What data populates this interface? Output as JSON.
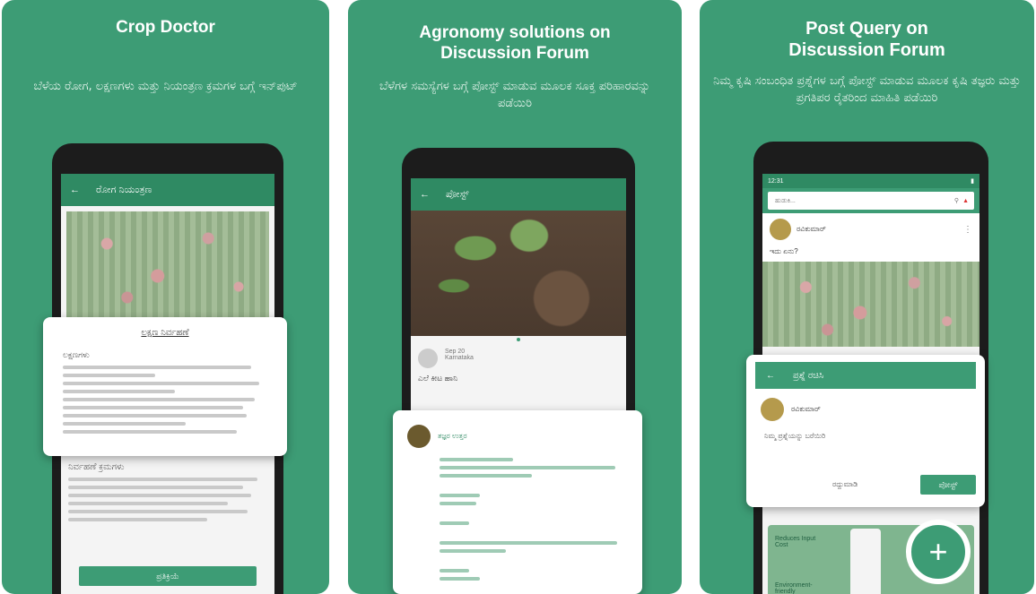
{
  "panels": [
    {
      "title": "Crop Doctor",
      "subtitle": "ಬೆಳೆಯ ರೋಗ, ಲಕ್ಷಣಗಳು ಮತ್ತು ನಿಯಂತ್ರಣ ಕ್ರಮಗಳ ಬಗ್ಗೆ ಇನ್‌ಪುಟ್",
      "app_title": "ರೋಗ ನಿಯಂತ್ರಣ",
      "card_title": "ಲಕ್ಷಣ ನಿರ್ವಹಣೆ",
      "card_heading": "ಲಕ್ಷಣಗಳು",
      "lower_heading": "ನಿರ್ವಹಣೆ ಕ್ರಮಗಳು",
      "bottom_button": "ಪ್ರತಿಕ್ರಿಯೆ"
    },
    {
      "title": "Agronomy solutions on Discussion Forum",
      "subtitle": "ಬೆಳೆಗಳ ಸಮಸ್ಯೆಗಳ ಬಗ್ಗೆ ಪೋಸ್ಟ್ ಮಾಡುವ ಮೂಲಕ ಸೂಕ್ತ ಪರಿಹಾರವನ್ನು ಪಡೆಯಿರಿ",
      "app_title": "ಪೋಸ್ಟ್",
      "post_date": "Sep 20",
      "post_location": "Karnataka",
      "post_question": "ಎಲೆ ಕೀಟ ಹಾನಿ",
      "reply_author": "ತಜ್ಞರ ಉತ್ತರ"
    },
    {
      "title": "Post Query on Discussion Forum",
      "subtitle": "ನಿಮ್ಮ ಕೃಷಿ ಸಂಬಂಧಿತ ಪ್ರಶ್ನೆಗಳ ಬಗ್ಗೆ ಪೋಸ್ಟ್ ಮಾಡುವ ಮೂಲಕ ಕೃಷಿ ತಜ್ಞರು ಮತ್ತು ಪ್ರಗತಿಪರ ರೈತರಿಂದ ಮಾಹಿತಿ ಪಡೆಯಿರಿ",
      "status_time": "12:31",
      "search_placeholder": "ಹುಡುಕಿ...",
      "post_author": "ರವಿಕುಮಾರ್",
      "post_text": "ಇದು ಏನು?",
      "dialog_title": "ಪ್ರಶ್ನೆ ರಚಿಸಿ",
      "dialog_author": "ರವಿಕುಮಾರ್",
      "dialog_prompt": "ನಿಮ್ಮ ಪ್ರಶ್ನೆಯನ್ನು ಬರೆಯಿರಿ",
      "dialog_cancel": "ರದ್ದುಮಾಡಿ",
      "dialog_submit": "ಪೋಸ್ಟ್",
      "promo_1": "Reduces Input Cost",
      "promo_2": "Environment-friendly",
      "fab_label": "+"
    }
  ],
  "colors": {
    "brand_green": "#3d9c75",
    "appbar_green": "#2f8a63"
  }
}
